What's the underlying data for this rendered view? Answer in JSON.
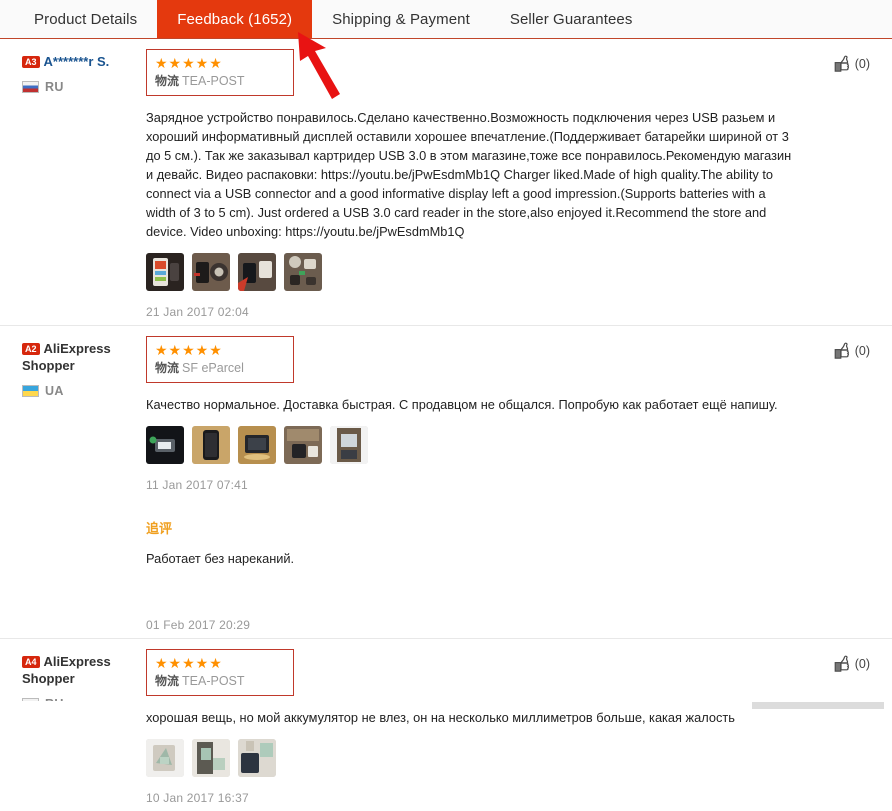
{
  "tabs": [
    {
      "label": "Product Details",
      "active": false
    },
    {
      "label": "Feedback (1652)",
      "active": true
    },
    {
      "label": "Shipping & Payment",
      "active": false
    },
    {
      "label": "Seller Guarantees",
      "active": false
    }
  ],
  "annotation": {
    "type": "arrow",
    "color": "#e81313",
    "points_to": "Feedback (1652)"
  },
  "colors": {
    "accent": "#e4390e",
    "tab_underline": "#c0462a",
    "star": "#ff9000",
    "highlight_box_border": "#c0392b",
    "badge": "#d6270d",
    "append_title": "#f0a020",
    "username_link": "#1a5490",
    "muted": "#999999"
  },
  "stars_glyph": "★★★★★",
  "helpful_icon": "thumbs-up-icon",
  "reviews": [
    {
      "level_badge": "A3",
      "user_name": "A*******r S.",
      "user_name_is_link": true,
      "country_code": "RU",
      "flag": "flag-ru",
      "rating": 5,
      "logistics_label": "物流",
      "carrier": "TEA-POST",
      "text": "Зарядное устройство понравилось.Сделано качественно.Возможность подключения через USB разьем и хороший информативный дисплей оставили хорошее впечатление.(Поддерживает батарейки шириной от 3 до 5 см.). Так же заказывал картридер USB 3.0 в этом магазине,тоже все понравилось.Рекомендую магазин и девайс. Видео распаковки: https://youtu.be/jPwEsdmMb1Q Charger liked.Made of high quality.The ability to connect via a USB connector and a good informative display left a good impression.(Supports batteries with a width of 3 to 5 cm). Just ordered a USB 3.0 card reader in the store,also enjoyed it.Recommend the store and device. Video unboxing: https://youtu.be/jPwEsdmMb1Q",
      "photo_count": 4,
      "timestamp": "21 Jan 2017 02:04",
      "helpful_count": "(0)",
      "append": null
    },
    {
      "level_badge": "A2",
      "user_name": "AliExpress Shopper",
      "user_name_is_link": false,
      "country_code": "UA",
      "flag": "flag-ua",
      "rating": 5,
      "logistics_label": "物流",
      "carrier": "SF eParcel",
      "text": "Качество нормальное. Доставка быстрая. С продавцом не общался. Попробую как работает ещё напишу.",
      "photo_count": 5,
      "timestamp": "11 Jan 2017 07:41",
      "helpful_count": "(0)",
      "append": {
        "title": "追评",
        "text": "Работает без нареканий.",
        "timestamp": "01 Feb 2017 20:29"
      }
    },
    {
      "level_badge": "A4",
      "user_name": "AliExpress Shopper",
      "user_name_is_link": false,
      "country_code": "RU",
      "flag": "flag-ru",
      "rating": 5,
      "logistics_label": "物流",
      "carrier": "TEA-POST",
      "text": "хорошая вещь, но мой аккумулятор не влез, он на несколько миллиметров больше, какая жалость",
      "photo_count": 3,
      "timestamp": "10 Jan 2017 16:37",
      "helpful_count": "(0)",
      "append": null
    }
  ]
}
